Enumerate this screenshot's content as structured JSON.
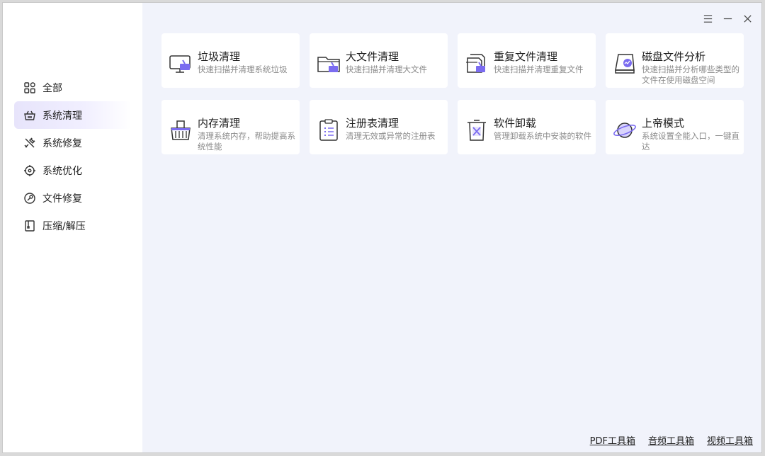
{
  "window": {
    "menu_icon": "menu-icon",
    "minimize_icon": "minimize-icon",
    "close_icon": "close-icon"
  },
  "sidebar": {
    "items": [
      {
        "label": "全部",
        "icon": "grid-icon",
        "active": false
      },
      {
        "label": "系统清理",
        "icon": "basket-icon",
        "active": true
      },
      {
        "label": "系统修复",
        "icon": "tools-icon",
        "active": false
      },
      {
        "label": "系统优化",
        "icon": "target-icon",
        "active": false
      },
      {
        "label": "文件修复",
        "icon": "wrench-circle-icon",
        "active": false
      },
      {
        "label": "压缩/解压",
        "icon": "archive-icon",
        "active": false
      }
    ]
  },
  "cards": [
    {
      "title": "垃圾清理",
      "desc": "快速扫描并清理系统垃圾",
      "icon": "monitor-broom-icon"
    },
    {
      "title": "大文件清理",
      "desc": "快速扫描并清理大文件",
      "icon": "folder-broom-icon"
    },
    {
      "title": "重复文件清理",
      "desc": "快速扫描并清理重复文件",
      "icon": "duplicate-files-icon"
    },
    {
      "title": "磁盘文件分析",
      "desc": "快速扫描并分析哪些类型的文件在使用磁盘空间",
      "icon": "disk-analysis-icon"
    },
    {
      "title": "内存清理",
      "desc": "清理系统内存，帮助提高系统性能",
      "icon": "memory-broom-icon"
    },
    {
      "title": "注册表清理",
      "desc": "清理无效或异常的注册表",
      "icon": "registry-clipboard-icon"
    },
    {
      "title": "软件卸载",
      "desc": "管理卸载系统中安装的软件",
      "icon": "uninstall-trash-icon"
    },
    {
      "title": "上帝模式",
      "desc": "系统设置全能入口，一键直达",
      "icon": "planet-icon"
    }
  ],
  "footer": {
    "links": [
      "PDF工具箱",
      "音频工具箱",
      "视频工具箱"
    ]
  },
  "colors": {
    "accent": "#7b6cf0",
    "content_bg": "#f1f3fb",
    "active_nav_bg": "#e7e4fb"
  }
}
